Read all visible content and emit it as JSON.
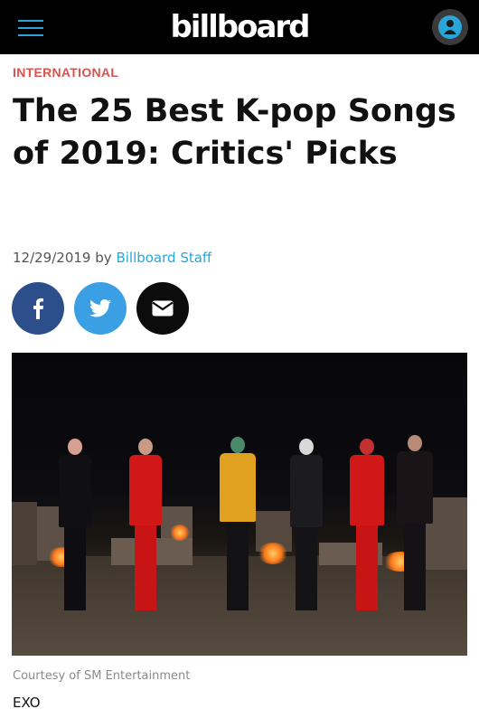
{
  "header": {
    "logo_text": "billboard",
    "menu_icon": "hamburger-menu-icon",
    "account_icon": "user-icon"
  },
  "article": {
    "category": "INTERNATIONAL",
    "title": "The 25 Best K-pop Songs of 2019: Critics' Picks",
    "date": "12/29/2019",
    "by": "by",
    "author": "Billboard Staff"
  },
  "share": {
    "facebook_icon": "facebook-icon",
    "twitter_icon": "twitter-icon",
    "email_icon": "email-icon"
  },
  "image": {
    "credit": "Courtesy of SM Entertainment",
    "caption": "EXO"
  },
  "colors": {
    "header_bg": "#000000",
    "accent_blue": "#2aa5d8",
    "category_red": "#d9534f",
    "facebook_blue": "#2c4f8c",
    "twitter_blue": "#3ba0e3"
  }
}
